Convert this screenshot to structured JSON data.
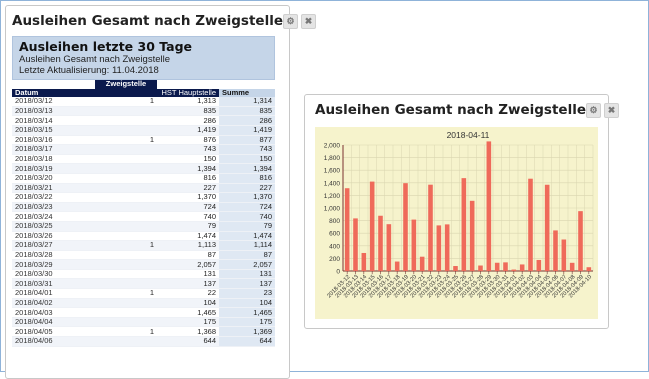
{
  "left_panel": {
    "title": "Ausleihen Gesamt nach Zweigstelle"
  },
  "right_panel": {
    "title": "Ausleihen Gesamt nach Zweigstelle"
  },
  "panel_icons": {
    "settings": "gear-icon",
    "close": "close-icon"
  },
  "report": {
    "title": "Ausleihen letzte 30 Tage",
    "subtitle": "Ausleihen Gesamt nach Zweigstelle",
    "updated": "Letzte Aktualisierung: 11.04.2018",
    "group_header": "Zweigstelle",
    "columns": {
      "date": "Datum",
      "col1": "",
      "col2": "HST Hauptstelle",
      "sum": "Summe"
    },
    "rows": [
      {
        "d": "2018/03/12",
        "a": "1",
        "b": "1,313",
        "s": "1,314"
      },
      {
        "d": "2018/03/13",
        "a": "",
        "b": "835",
        "s": "835"
      },
      {
        "d": "2018/03/14",
        "a": "",
        "b": "286",
        "s": "286"
      },
      {
        "d": "2018/03/15",
        "a": "",
        "b": "1,419",
        "s": "1,419"
      },
      {
        "d": "2018/03/16",
        "a": "1",
        "b": "876",
        "s": "877"
      },
      {
        "d": "2018/03/17",
        "a": "",
        "b": "743",
        "s": "743"
      },
      {
        "d": "2018/03/18",
        "a": "",
        "b": "150",
        "s": "150"
      },
      {
        "d": "2018/03/19",
        "a": "",
        "b": "1,394",
        "s": "1,394"
      },
      {
        "d": "2018/03/20",
        "a": "",
        "b": "816",
        "s": "816"
      },
      {
        "d": "2018/03/21",
        "a": "",
        "b": "227",
        "s": "227"
      },
      {
        "d": "2018/03/22",
        "a": "",
        "b": "1,370",
        "s": "1,370"
      },
      {
        "d": "2018/03/23",
        "a": "",
        "b": "724",
        "s": "724"
      },
      {
        "d": "2018/03/24",
        "a": "",
        "b": "740",
        "s": "740"
      },
      {
        "d": "2018/03/25",
        "a": "",
        "b": "79",
        "s": "79"
      },
      {
        "d": "2018/03/26",
        "a": "",
        "b": "1,474",
        "s": "1,474"
      },
      {
        "d": "2018/03/27",
        "a": "1",
        "b": "1,113",
        "s": "1,114"
      },
      {
        "d": "2018/03/28",
        "a": "",
        "b": "87",
        "s": "87"
      },
      {
        "d": "2018/03/29",
        "a": "",
        "b": "2,057",
        "s": "2,057"
      },
      {
        "d": "2018/03/30",
        "a": "",
        "b": "131",
        "s": "131"
      },
      {
        "d": "2018/03/31",
        "a": "",
        "b": "137",
        "s": "137"
      },
      {
        "d": "2018/04/01",
        "a": "1",
        "b": "22",
        "s": "23"
      },
      {
        "d": "2018/04/02",
        "a": "",
        "b": "104",
        "s": "104"
      },
      {
        "d": "2018/04/03",
        "a": "",
        "b": "1,465",
        "s": "1,465"
      },
      {
        "d": "2018/04/04",
        "a": "",
        "b": "175",
        "s": "175"
      },
      {
        "d": "2018/04/05",
        "a": "1",
        "b": "1,368",
        "s": "1,369"
      },
      {
        "d": "2018/04/06",
        "a": "",
        "b": "644",
        "s": "644"
      }
    ]
  },
  "chart_data": {
    "type": "bar",
    "title": "2018-04-11",
    "xlabel": "",
    "ylabel": "",
    "ylim": [
      0,
      2000
    ],
    "yticks": [
      0,
      200,
      400,
      600,
      800,
      1000,
      1200,
      1400,
      1600,
      1800,
      2000
    ],
    "ytick_labels": [
      "0",
      "200",
      "400",
      "600",
      "800",
      "1,000",
      "1,200",
      "1,400",
      "1,600",
      "1,800",
      "2,000"
    ],
    "grid": true,
    "colors": {
      "bar": "#ef6a5a",
      "background": "#f6f3cc",
      "grid": "#d9d6b0"
    },
    "categories": [
      "2018-03-12",
      "2018-03-13",
      "2018-03-14",
      "2018-03-15",
      "2018-03-16",
      "2018-03-17",
      "2018-03-18",
      "2018-03-19",
      "2018-03-20",
      "2018-03-21",
      "2018-03-22",
      "2018-03-23",
      "2018-03-24",
      "2018-03-25",
      "2018-03-26",
      "2018-03-27",
      "2018-03-28",
      "2018-03-29",
      "2018-03-30",
      "2018-03-31",
      "2018-04-01",
      "2018-04-02",
      "2018-04-03",
      "2018-04-04",
      "2018-04-05",
      "2018-04-06",
      "2018-04-07",
      "2018-04-08",
      "2018-04-09",
      "2018-04-10"
    ],
    "values": [
      1314,
      835,
      286,
      1419,
      877,
      743,
      150,
      1394,
      816,
      227,
      1370,
      724,
      740,
      79,
      1474,
      1114,
      87,
      2057,
      131,
      137,
      23,
      104,
      1465,
      175,
      1369,
      644,
      500,
      130,
      950,
      60
    ]
  }
}
